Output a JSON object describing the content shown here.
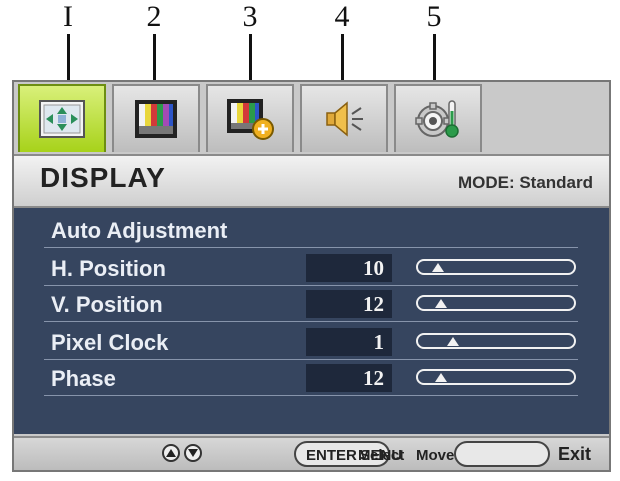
{
  "callouts": [
    "I",
    "2",
    "3",
    "4",
    "5"
  ],
  "tabs": [
    {
      "icon": "display-adjust-icon",
      "active": true
    },
    {
      "icon": "picture-icon"
    },
    {
      "icon": "picture-advanced-icon"
    },
    {
      "icon": "speaker-icon"
    },
    {
      "icon": "system-settings-icon"
    }
  ],
  "header": {
    "title": "DISPLAY",
    "mode": "MODE: Standard"
  },
  "menu": [
    {
      "label": "Auto Adjustment"
    },
    {
      "label": "H. Position",
      "value": "10",
      "slider_level": 0.1
    },
    {
      "label": "V. Position",
      "value": "12",
      "slider_level": 0.12
    },
    {
      "label": "Pixel Clock",
      "value": "1",
      "slider_level": 0.2
    },
    {
      "label": "Phase",
      "value": "12",
      "slider_level": 0.12
    }
  ],
  "footer": {
    "enter_label": "ENTER",
    "select_label": "Select",
    "menu_label": "MENU",
    "move_label": "Move",
    "exit_label": "Exit"
  },
  "colors": {
    "active_tab": "#a7d21a",
    "panel": "#36455f",
    "value_box": "#1e283b"
  }
}
